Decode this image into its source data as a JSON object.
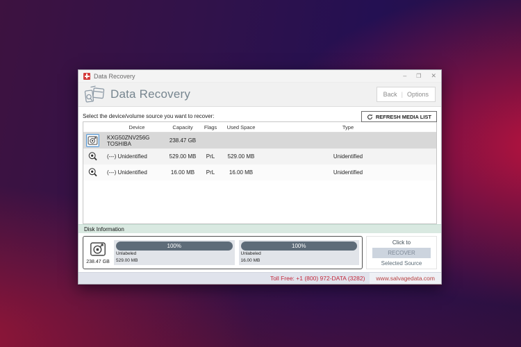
{
  "colors": {
    "accent_red": "#d43c3c",
    "selection_blue": "#5b9bd5",
    "partition_bar": "#5e6c79",
    "disk_info_header_bg": "#d9e9e1",
    "footer_text_red": "#c3273a"
  },
  "titlebar": {
    "title": "Data Recovery",
    "minimize": "–",
    "maximize": "❐",
    "close": "✕"
  },
  "header": {
    "title": "Data Recovery",
    "back": "Back",
    "separator": "|",
    "options": "Options"
  },
  "source": {
    "label": "Select the device/volume source you want to recover:",
    "refresh": "REFRESH MEDIA LIST"
  },
  "table": {
    "headers": {
      "device": "Device",
      "capacity": "Capacity",
      "flags": "Flags",
      "used": "Used Space",
      "type": "Type"
    },
    "rows": [
      {
        "device": "KXG50ZNV256G TOSHIBA",
        "capacity": "238.47 GB",
        "flags": "",
        "used": "",
        "type": ""
      },
      {
        "device": "(---) Unidentified",
        "capacity": "529.00 MB",
        "flags": "PrL",
        "used": "529.00 MB",
        "type": "Unidentified"
      },
      {
        "device": "(---) Unidentified",
        "capacity": "16.00 MB",
        "flags": "PrL",
        "used": "16.00 MB",
        "type": "Unidentified"
      }
    ]
  },
  "disk_info": {
    "title": "Disk Information",
    "capacity": "238.47 GB",
    "partitions": [
      {
        "percent": "100%",
        "label": "Unlabeled",
        "size": "529.00 MB"
      },
      {
        "percent": "100%",
        "label": "Unlabeled",
        "size": "16.00 MB"
      }
    ],
    "click_to": "Click to",
    "recover": "RECOVER",
    "selected_source": "Selected Source"
  },
  "footer": {
    "toll_free": "Toll Free: +1 (800) 972-DATA (3282)",
    "website": "www.salvagedata.com"
  }
}
